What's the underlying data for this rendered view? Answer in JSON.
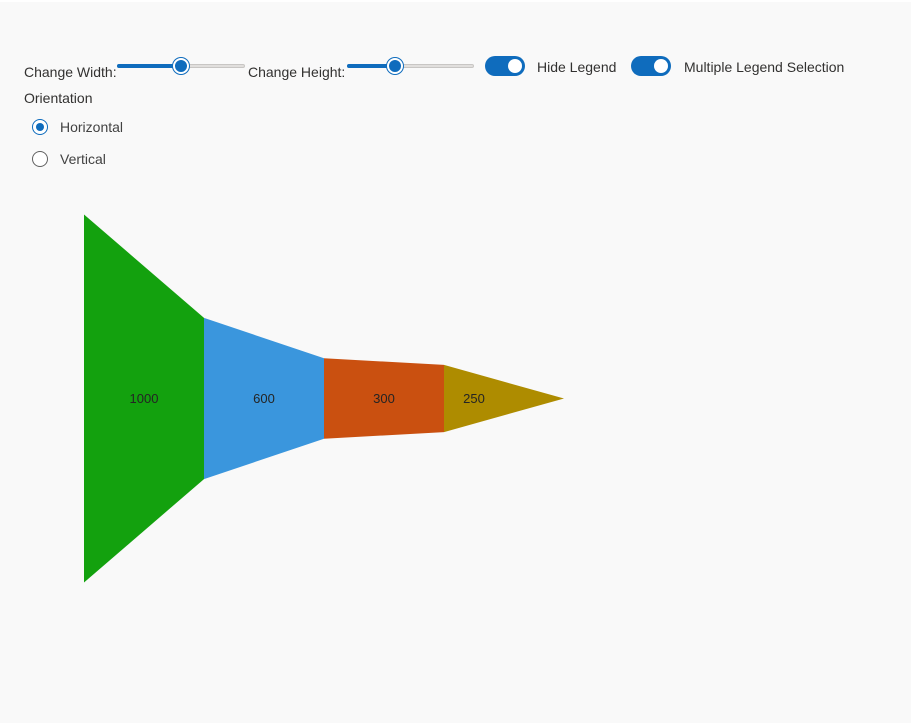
{
  "controls": {
    "width_label": "Change Width:",
    "height_label": "Change Height:",
    "width_slider_value": 0.5,
    "height_slider_value": 0.38,
    "hide_legend_label": "Hide Legend",
    "hide_legend_on": true,
    "multi_select_label": "Multiple Legend Selection",
    "multi_select_on": true
  },
  "orientation": {
    "label": "Orientation",
    "options": [
      "Horizontal",
      "Vertical"
    ],
    "selected": "Horizontal"
  },
  "chart_data": {
    "type": "funnel",
    "orientation": "horizontal",
    "values": [
      1000,
      600,
      300,
      250
    ],
    "labels": [
      "1000",
      "600",
      "300",
      "250"
    ],
    "colors": [
      "#13a10e",
      "#3a96dd",
      "#ca5010",
      "#ae8c00"
    ],
    "legend": "hidden"
  }
}
